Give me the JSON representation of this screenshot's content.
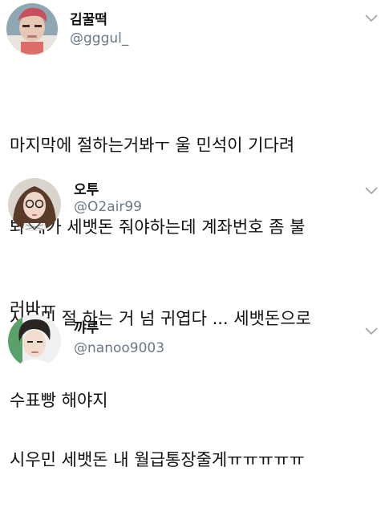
{
  "tweets": [
    {
      "display_name": "김꿀떡",
      "handle": "@gggul_",
      "text_lines": [
        "마지막에 절하는거봐ㅜ 울 민석이 기다려",
        "봐 내가 세뱃돈 줘야하는데 계좌번호 좀 불",
        "러바ㅠ"
      ]
    },
    {
      "display_name": "오투",
      "handle": "@O2air99",
      "text_lines": [
        "시우민 절 하는 거 넘 귀엽다 ... 세뱃돈으로",
        "수표빵 해야지"
      ]
    },
    {
      "display_name": "꺄루",
      "handle": "@nanoo9003",
      "text_lines": [
        "시우민 세뱃돈 내 월급통장줄게ㅠㅠㅠㅠㅠ"
      ]
    }
  ],
  "icons": {
    "menu": "chevron-down-icon"
  },
  "colors": {
    "handle": "#6b7883",
    "text": "#111111",
    "chevron": "#9aa4ad"
  }
}
